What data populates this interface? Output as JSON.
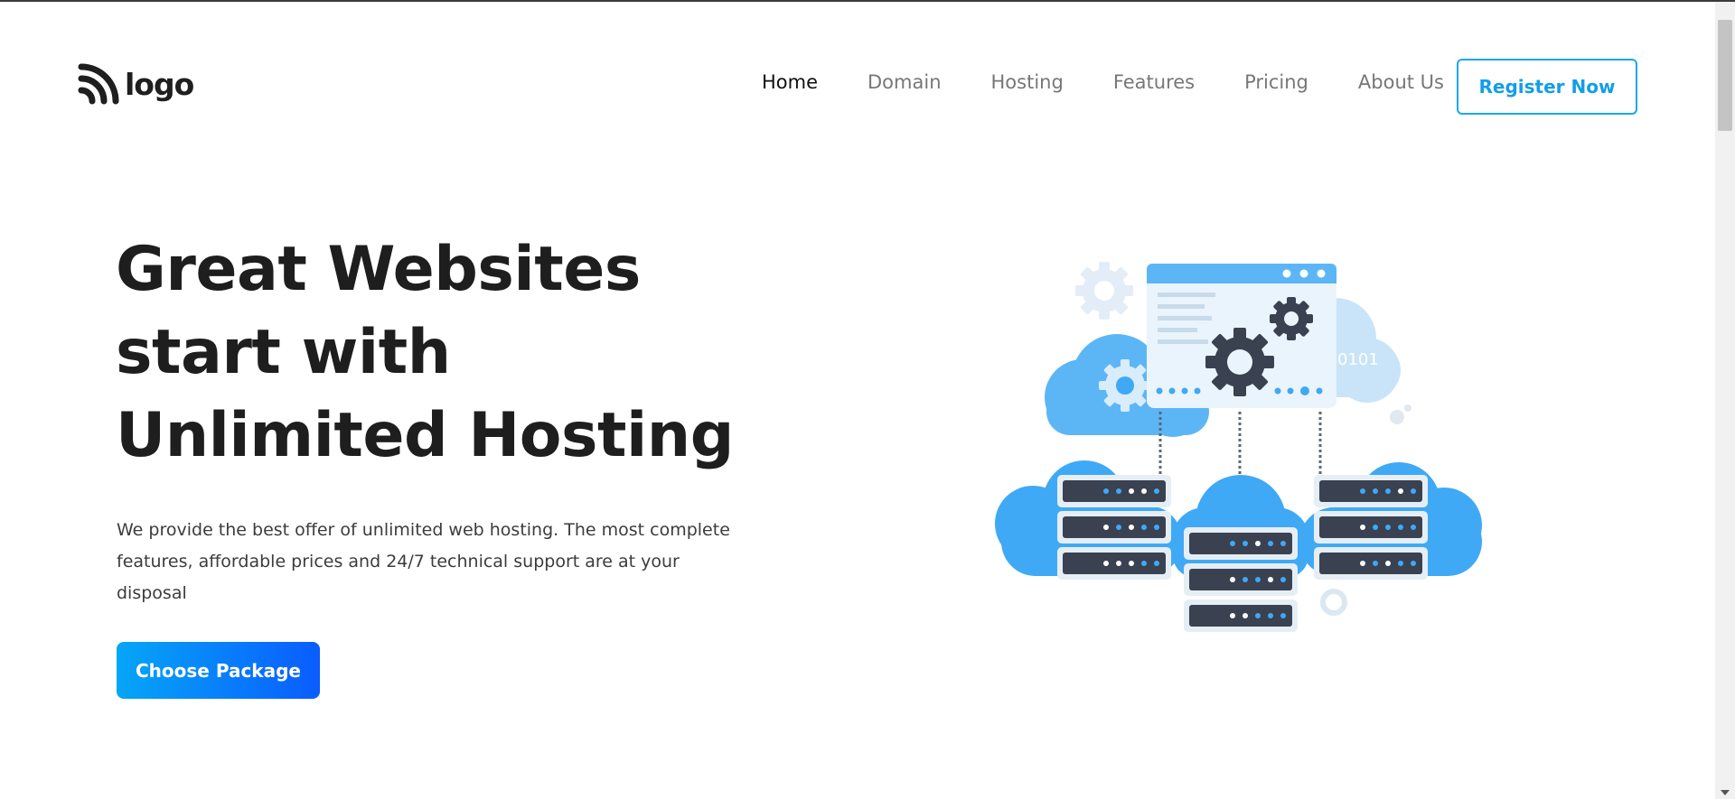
{
  "header": {
    "logo_text": "logo",
    "logo_icon": "rss-like-arcs-icon",
    "nav": [
      {
        "label": "Home",
        "active": true
      },
      {
        "label": "Domain",
        "active": false
      },
      {
        "label": "Hosting",
        "active": false
      },
      {
        "label": "Features",
        "active": false
      },
      {
        "label": "Pricing",
        "active": false
      },
      {
        "label": "About Us",
        "active": false
      }
    ],
    "register_label": "Register Now"
  },
  "hero": {
    "title": "Great Websites start with Unlimited Hosting",
    "description": "We provide the best offer of unlimited web hosting. The most complete features, affordable prices and 24/7 technical support are at your disposal",
    "cta_label": "Choose Package",
    "illustration": {
      "name": "cloud-hosting-servers-illustration",
      "binary_text": "0101"
    }
  },
  "colors": {
    "accent": "#129ee8",
    "cta_gradient_start": "#06a6f6",
    "cta_gradient_end": "#0a5cff",
    "cloud_blue": "#3fa9f5",
    "server_dark": "#3a4150",
    "text_dark": "#1e1e1e",
    "nav_gray": "#777777"
  }
}
